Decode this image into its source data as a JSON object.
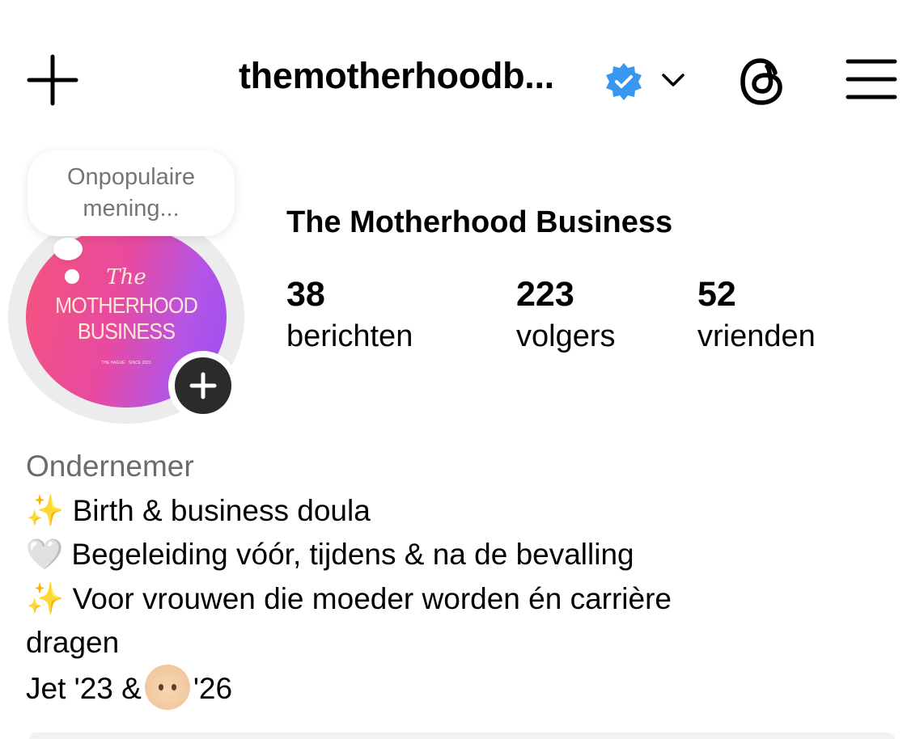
{
  "header": {
    "username": "themotherhoodb...",
    "icons": {
      "create": "plus-icon",
      "verified": "verified-badge-icon",
      "account_switch": "chevron-down-icon",
      "threads": "threads-icon",
      "menu": "hamburger-menu-icon"
    },
    "verified_color": "#3897f0"
  },
  "note": {
    "text": "Onpopulaire mening..."
  },
  "profile": {
    "display_name": "The Motherhood Business",
    "avatar_logo": {
      "the": "The",
      "main": "MOTHERHOOD BUSINESS",
      "small": "THE HAGUE · SINCE 2023"
    },
    "stats": [
      {
        "value": "38",
        "label": "berichten"
      },
      {
        "value": "223",
        "label": "volgers"
      },
      {
        "value": "52",
        "label": "vrienden"
      }
    ]
  },
  "bio": {
    "category": "Ondernemer",
    "lines": [
      {
        "emoji": "✨",
        "text": "Birth & business doula"
      },
      {
        "emoji": "🤍",
        "text": "Begeleiding vóór, tijdens & na de bevalling"
      },
      {
        "emoji": "✨",
        "text": "Voor vrouwen die moeder worden én carrière"
      },
      {
        "emoji": "",
        "text": "dragen"
      }
    ],
    "last_line": {
      "before": "Jet '23 &",
      "after": "'26"
    }
  },
  "colors": {
    "avatar_gradient_start": "#f5547a",
    "avatar_gradient_end": "#9b4cf2",
    "category_text": "#6b6b6b"
  }
}
